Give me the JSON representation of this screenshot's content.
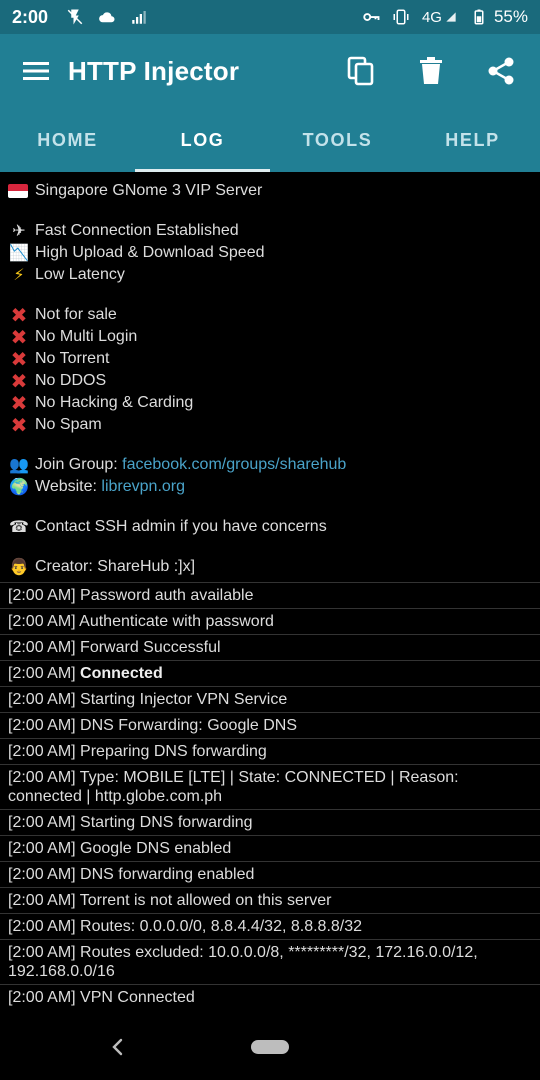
{
  "status_bar": {
    "time": "2:00",
    "network": "4G",
    "battery": "55%",
    "icons_left": [
      "no-charging-icon",
      "cloud-icon",
      "signal-icon"
    ],
    "icons_right": [
      "vpn-key-icon",
      "vibrate-icon",
      "network-4g-icon",
      "battery-icon"
    ]
  },
  "app_bar": {
    "title": "HTTP Injector",
    "icons": [
      "menu-icon",
      "copy-icon",
      "delete-icon",
      "share-icon"
    ]
  },
  "tabs": [
    {
      "label": "HOME",
      "active": false
    },
    {
      "label": "LOG",
      "active": true
    },
    {
      "label": "TOOLS",
      "active": false
    },
    {
      "label": "HELP",
      "active": false
    }
  ],
  "banner": {
    "server": "Singapore GNome 3 VIP Server",
    "features": [
      {
        "icon": "✈",
        "text": "Fast Connection Established"
      },
      {
        "icon": "📉",
        "text": "High Upload & Download Speed"
      },
      {
        "icon": "⚡",
        "text": "Low Latency"
      }
    ],
    "rules": [
      "Not for sale",
      "No Multi Login",
      "No Torrent",
      "No DDOS",
      "No Hacking & Carding",
      "No Spam"
    ],
    "join_group_label": "Join Group: ",
    "join_group_link": "facebook.com/groups/sharehub",
    "website_label": "Website: ",
    "website_link": "librevpn.org",
    "contact": "Contact SSH admin if you have concerns",
    "creator": "Creator: ShareHub :]x]"
  },
  "log_entries": [
    {
      "time": "[2:00 AM]",
      "text": "Password auth available"
    },
    {
      "time": "[2:00 AM]",
      "text": "Authenticate with password"
    },
    {
      "time": "[2:00 AM]",
      "text": "Forward Successful"
    },
    {
      "time": "[2:00 AM]",
      "text": "Connected",
      "bold": true
    },
    {
      "time": "[2:00 AM]",
      "text": "Starting Injector VPN Service"
    },
    {
      "time": "[2:00 AM]",
      "text": "DNS Forwarding: Google DNS"
    },
    {
      "time": "[2:00 AM]",
      "text": "Preparing DNS forwarding"
    },
    {
      "time": "[2:00 AM]",
      "text": "Type: MOBILE [LTE] | State: CONNECTED | Reason: connected | http.globe.com.ph"
    },
    {
      "time": "[2:00 AM]",
      "text": "Starting DNS forwarding"
    },
    {
      "time": "[2:00 AM]",
      "text": "Google DNS enabled"
    },
    {
      "time": "[2:00 AM]",
      "text": "DNS forwarding enabled"
    },
    {
      "time": "[2:00 AM]",
      "text": "Torrent is not allowed on this server"
    },
    {
      "time": "[2:00 AM]",
      "text": "Routes: 0.0.0.0/0, 8.8.4.4/32, 8.8.8.8/32"
    },
    {
      "time": "[2:00 AM]",
      "text": "Routes excluded: 10.0.0.0/8, *********/32, 172.16.0.0/12, 192.168.0.0/16"
    },
    {
      "time": "[2:00 AM]",
      "text": "VPN Connected"
    }
  ],
  "colors": {
    "status_bar": "#1a6a7c",
    "app_bar": "#217f94",
    "background": "#000000",
    "link": "#4aa3c9",
    "error_mark": "#d93a3a"
  }
}
